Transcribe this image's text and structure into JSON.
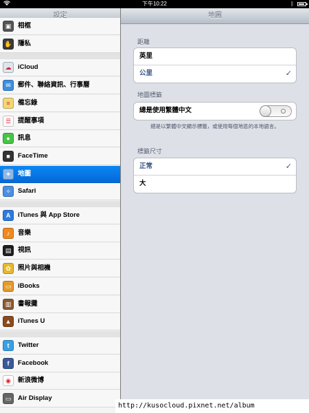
{
  "statusbar": {
    "time": "下午10:22",
    "battery": 0.85
  },
  "sidebar": {
    "title": "設定",
    "items": [
      {
        "label": "相框",
        "icon": "photo-frame-icon",
        "color": "#555555"
      },
      {
        "label": "隱私",
        "icon": "privacy-hand-icon",
        "color": "#3a3a3a"
      },
      {
        "label": "iCloud",
        "icon": "cloud-icon",
        "color": "#dde5ee"
      },
      {
        "label": "郵件、聯絡資訊、行事曆",
        "icon": "mail-icon",
        "color": "#3d8fe0"
      },
      {
        "label": "備忘錄",
        "icon": "notes-icon",
        "color": "#f2d873"
      },
      {
        "label": "提醒事項",
        "icon": "reminders-icon",
        "color": "#ffffff"
      },
      {
        "label": "訊息",
        "icon": "messages-icon",
        "color": "#47c447"
      },
      {
        "label": "FaceTime",
        "icon": "camera-icon",
        "color": "#333333"
      },
      {
        "label": "地圖",
        "icon": "map-icon",
        "color": "#8fb8e6"
      },
      {
        "label": "Safari",
        "icon": "compass-icon",
        "color": "#4a90e2"
      },
      {
        "label": "iTunes 與 App Store",
        "icon": "app-store-icon",
        "color": "#2c7ae0"
      },
      {
        "label": "音樂",
        "icon": "music-note-icon",
        "color": "#f08a1c"
      },
      {
        "label": "視訊",
        "icon": "film-icon",
        "color": "#1e1e1e"
      },
      {
        "label": "照片與相機",
        "icon": "sunflower-icon",
        "color": "#e6b82e"
      },
      {
        "label": "iBooks",
        "icon": "book-icon",
        "color": "#e69a2a"
      },
      {
        "label": "書報攤",
        "icon": "bookshelf-icon",
        "color": "#8a5a32"
      },
      {
        "label": "iTunes U",
        "icon": "graduation-cap-icon",
        "color": "#8a4b1e"
      },
      {
        "label": "Twitter",
        "icon": "twitter-bird-icon",
        "color": "#3aa0e4"
      },
      {
        "label": "Facebook",
        "icon": "facebook-f-icon",
        "color": "#3b5998"
      },
      {
        "label": "新浪微博",
        "icon": "weibo-icon",
        "color": "#ffffff"
      },
      {
        "label": "Air Display",
        "icon": "display-icon",
        "color": "#666666"
      }
    ]
  },
  "detail": {
    "title": "地圖",
    "distance": {
      "header": "距離",
      "options": [
        "英里",
        "公里"
      ],
      "selected": 1
    },
    "labels": {
      "header": "地圖標籤",
      "toggle_label": "總是使用繁體中文",
      "toggle_on": false,
      "footnote": "總是以繁體中文顯示標籤，或使用每個地區的本地語言。"
    },
    "label_size": {
      "header": "標籤尺寸",
      "options": [
        "正常",
        "大"
      ],
      "selected": 0
    }
  },
  "watermark": "http://kusocloud.pixnet.net/album",
  "accent": "#0b87f3"
}
